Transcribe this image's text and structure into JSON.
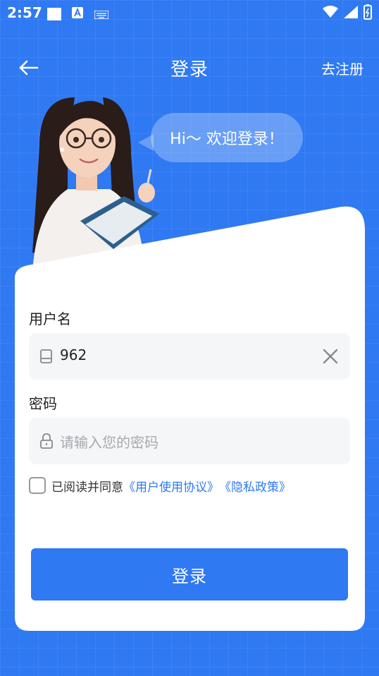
{
  "status": {
    "time": "2:57"
  },
  "header": {
    "title": "登录",
    "register_label": "去注册"
  },
  "greeting": "Hi～ 欢迎登录！",
  "form": {
    "username": {
      "label": "用户名",
      "value": "962"
    },
    "password": {
      "label": "密码",
      "placeholder": "请输入您的密码"
    },
    "agreement": {
      "prefix": "已阅读并同意",
      "user_agreement": "《用户使用协议》",
      "privacy_policy": "《隐私政策》"
    },
    "submit_label": "登录"
  },
  "colors": {
    "primary": "#2f79f2",
    "card": "#ffffff",
    "field_bg": "#f5f6f8"
  }
}
